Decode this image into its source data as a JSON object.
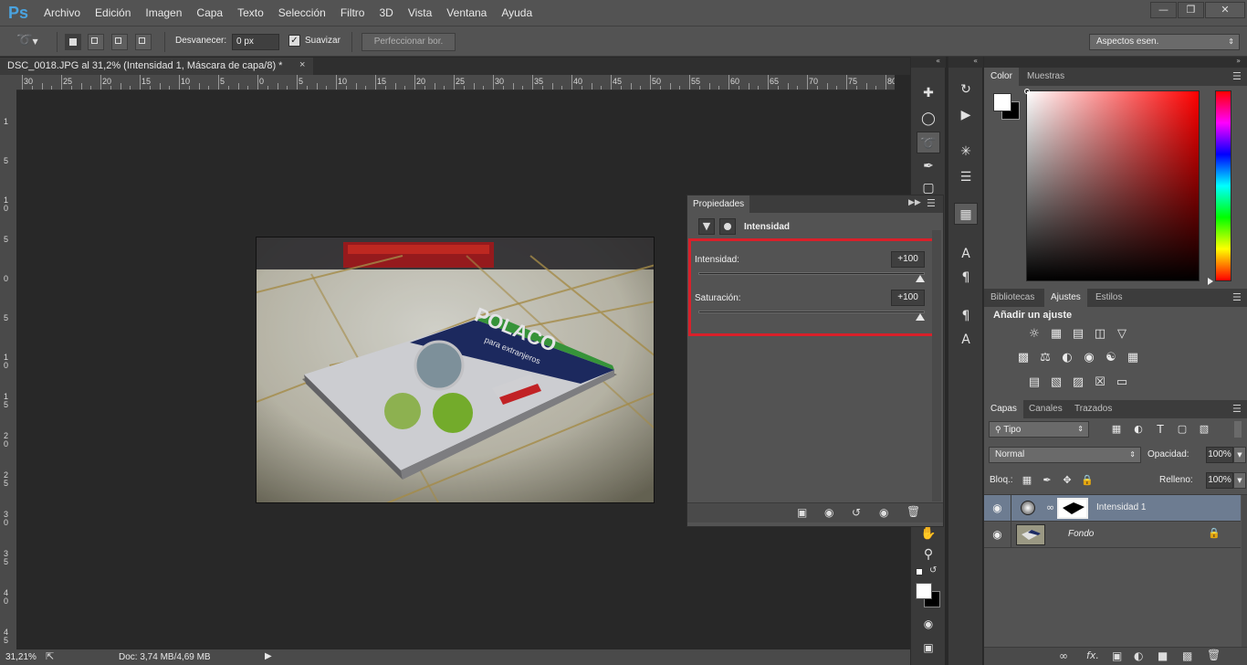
{
  "menubar": {
    "logo": "Ps",
    "items": [
      "Archivo",
      "Edición",
      "Imagen",
      "Capa",
      "Texto",
      "Selección",
      "Filtro",
      "3D",
      "Vista",
      "Ventana",
      "Ayuda"
    ]
  },
  "options": {
    "feather_label": "Desvanecer:",
    "feather_value": "0 px",
    "antialias_label": "Suavizar",
    "refine_button": "Perfeccionar bor.",
    "workspace": "Aspectos esen."
  },
  "document": {
    "tab_title": "DSC_0018.JPG al 31,2% (Intensidad 1, Máscara de capa/8) *",
    "close_glyph": "×"
  },
  "rulers": {
    "h_ticks": [
      "30",
      "25",
      "20",
      "15",
      "10",
      "5",
      "0",
      "5",
      "10",
      "15",
      "20",
      "25",
      "30",
      "35",
      "40",
      "45",
      "50",
      "55",
      "60",
      "65",
      "70",
      "75",
      "80"
    ],
    "v_ticks": [
      "1",
      "5",
      "1 0",
      "5",
      "0",
      "5",
      "1 0",
      "1 5",
      "2 0",
      "2 5",
      "3 0",
      "3 5",
      "4 0",
      "4 5"
    ]
  },
  "status": {
    "zoom": "31,21%",
    "doc": "Doc: 3,74 MB/4,69 MB"
  },
  "properties": {
    "tab_label": "Propiedades",
    "title": "Intensidad",
    "vibrance_label": "Intensidad:",
    "vibrance_value": "+100",
    "vibrance_level": 1.0,
    "saturation_label": "Saturación:",
    "saturation_value": "+100",
    "saturation_level": 1.0,
    "highlight_color": "#d9202a"
  },
  "color_panel": {
    "tabs": [
      "Color",
      "Muestras"
    ],
    "foreground": "#ffffff",
    "background": "#000000"
  },
  "adjustments_panel": {
    "tabs": [
      "Bibliotecas",
      "Ajustes",
      "Estilos"
    ],
    "heading": "Añadir un ajuste"
  },
  "layers_panel": {
    "tabs": [
      "Capas",
      "Canales",
      "Trazados"
    ],
    "filter": "Tipo",
    "blend_mode": "Normal",
    "opacity_label": "Opacidad:",
    "opacity_value": "100%",
    "lock_label": "Bloq.:",
    "fill_label": "Relleno:",
    "fill_value": "100%",
    "layers": [
      {
        "name": "Intensidad 1",
        "selected": true
      },
      {
        "name": "Fondo",
        "selected": false
      }
    ]
  },
  "photo": {
    "book_title": "POLACO",
    "book_subtitle": "para extranjeros"
  }
}
